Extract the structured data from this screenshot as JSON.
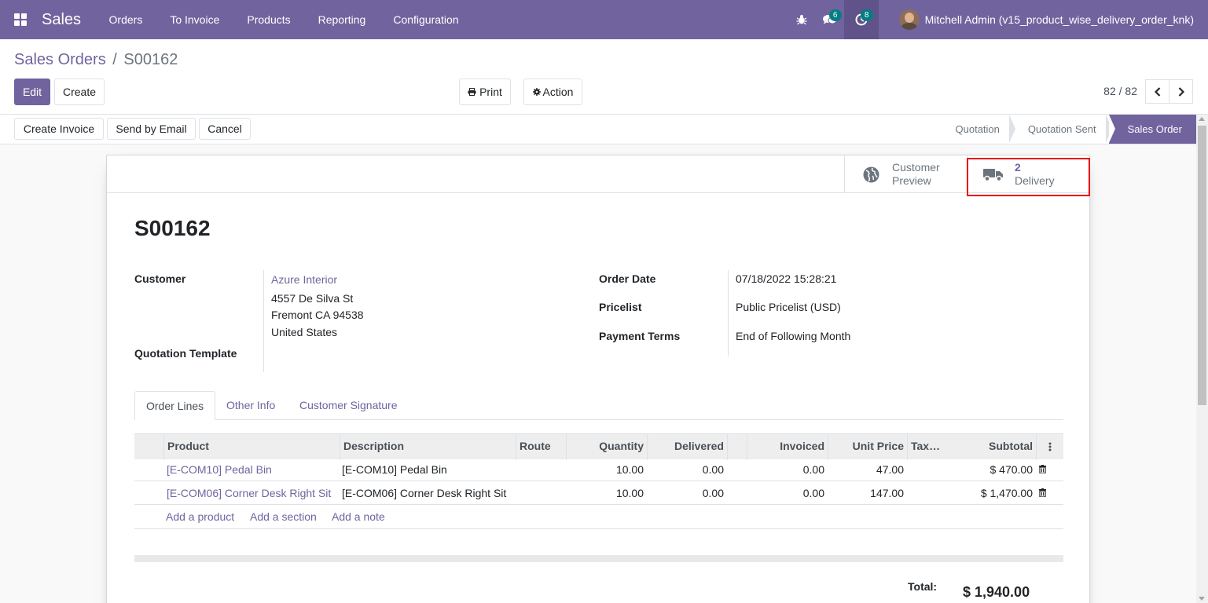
{
  "navbar": {
    "app_name": "Sales",
    "menu": [
      "Orders",
      "To Invoice",
      "Products",
      "Reporting",
      "Configuration"
    ],
    "messages_count": "6",
    "activities_count": "8",
    "user": "Mitchell Admin (v15_product_wise_delivery_order_knk)"
  },
  "breadcrumb": {
    "parent": "Sales Orders",
    "separator": "/",
    "current": "S00162"
  },
  "buttons": {
    "edit": "Edit",
    "create": "Create",
    "print": "Print",
    "action": "Action"
  },
  "pager": {
    "value": "82 / 82"
  },
  "statusbar": {
    "create_invoice": "Create Invoice",
    "send_by_email": "Send by Email",
    "cancel": "Cancel",
    "stages": [
      "Quotation",
      "Quotation Sent",
      "Sales Order"
    ],
    "active_stage": "Sales Order"
  },
  "smart_buttons": {
    "customer_preview_line1": "Customer",
    "customer_preview_line2": "Preview",
    "delivery_count": "2",
    "delivery_label": "Delivery"
  },
  "order": {
    "name": "S00162",
    "customer_label": "Customer",
    "customer_name": "Azure Interior",
    "address_line1": "4557 De Silva St",
    "address_line2": "Fremont CA 94538",
    "address_line3": "United States",
    "quotation_template_label": "Quotation Template",
    "order_date_label": "Order Date",
    "order_date": "07/18/2022 15:28:21",
    "pricelist_label": "Pricelist",
    "pricelist": "Public Pricelist (USD)",
    "payment_terms_label": "Payment Terms",
    "payment_terms": "End of Following Month"
  },
  "tabs": [
    "Order Lines",
    "Other Info",
    "Customer Signature"
  ],
  "table": {
    "headers": {
      "product": "Product",
      "description": "Description",
      "route": "Route",
      "quantity": "Quantity",
      "delivered": "Delivered",
      "invoiced": "Invoiced",
      "unit_price": "Unit Price",
      "taxes": "Tax…",
      "subtotal": "Subtotal"
    },
    "rows": [
      {
        "product": "[E-COM10] Pedal Bin",
        "description": "[E-COM10] Pedal Bin",
        "quantity": "10.00",
        "delivered": "0.00",
        "invoiced": "0.00",
        "unit_price": "47.00",
        "subtotal": "$ 470.00"
      },
      {
        "product": "[E-COM06] Corner Desk Right Sit",
        "description": "[E-COM06] Corner Desk Right Sit",
        "quantity": "10.00",
        "delivered": "0.00",
        "invoiced": "0.00",
        "unit_price": "147.00",
        "subtotal": "$ 1,470.00"
      }
    ],
    "add_product": "Add a product",
    "add_section": "Add a section",
    "add_note": "Add a note"
  },
  "totals": {
    "label": "Total:",
    "value": "$ 1,940.00"
  },
  "colors": {
    "brand": "#71639e",
    "highlight": "#e8000b",
    "badge": "#017e84"
  }
}
